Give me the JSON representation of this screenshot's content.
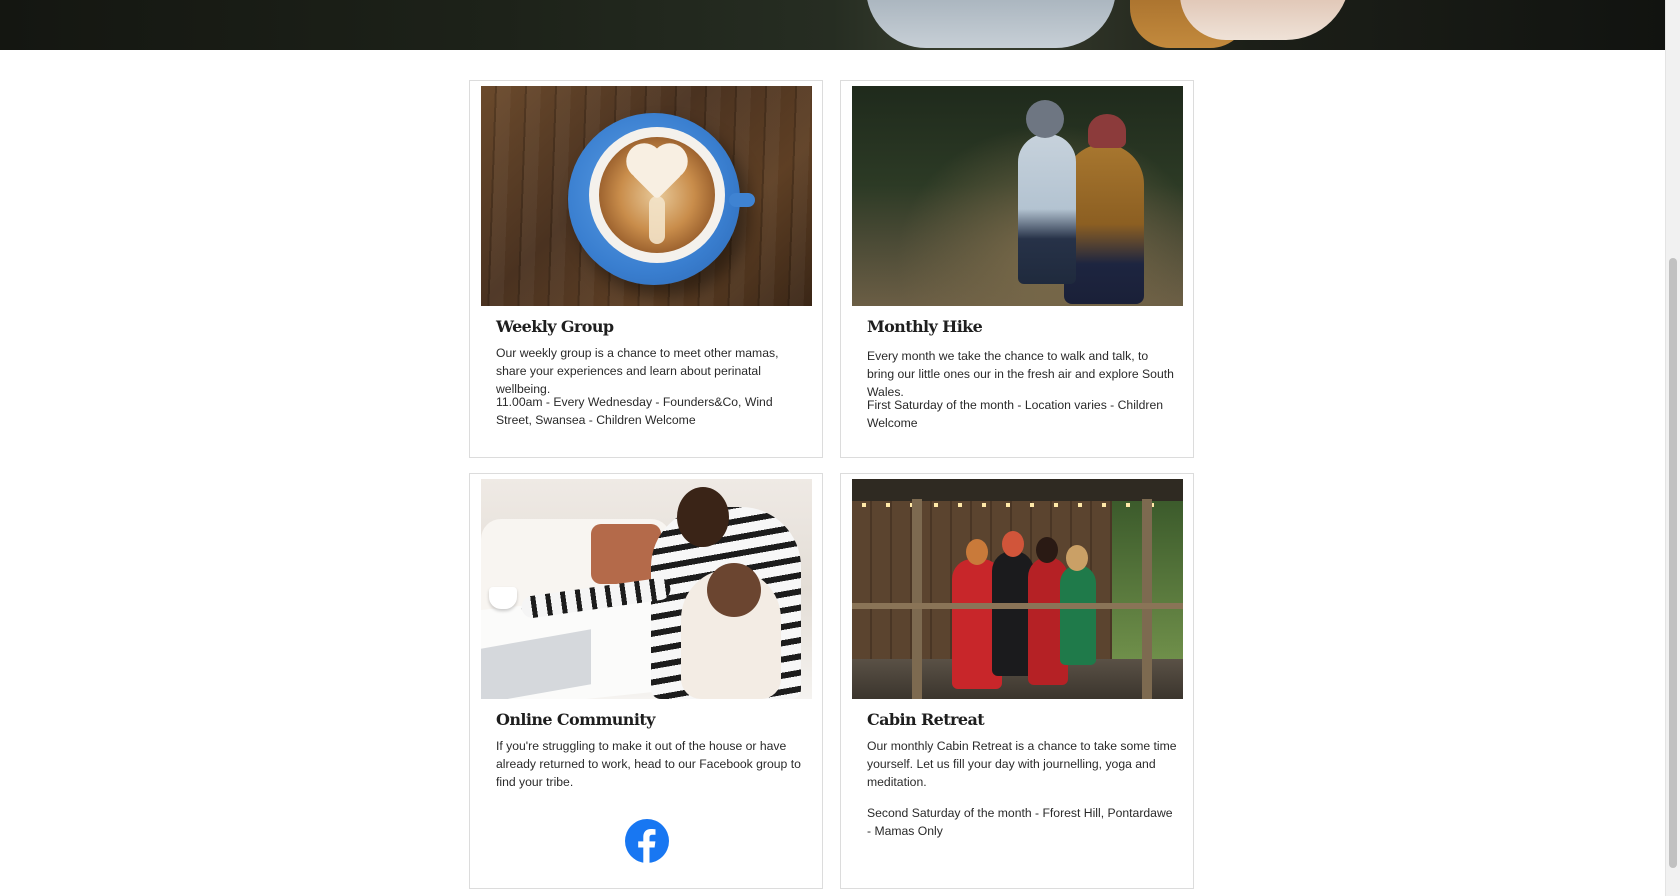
{
  "hero": {
    "image": "family-outdoor-banner"
  },
  "cards": [
    {
      "id": "weekly",
      "image": "latte-art-coffee-photo",
      "title": "Weekly Group",
      "description": "Our weekly group is a chance to meet other mamas, share your experiences and learn about perinatal wellbeing.",
      "details": "11.00am - Every Wednesday - Founders&Co, Wind Street, Swansea - Children Welcome"
    },
    {
      "id": "hike",
      "image": "mother-child-forest-photo",
      "title": "Monthly Hike",
      "description": "Every month we take the chance to walk and talk, to bring our little ones our in the fresh air and explore South Wales.",
      "details": "First Saturday of the month - Location varies - Children Welcome"
    },
    {
      "id": "online",
      "image": "mother-baby-laptop-photo",
      "title": "Online Community",
      "description": "If you're struggling to make it out of the house or have already returned to work, head to our Facebook group to find your tribe.",
      "link_icon": "facebook-icon"
    },
    {
      "id": "cabin",
      "image": "women-cabin-porch-photo",
      "title": "Cabin Retreat",
      "description": "Our monthly Cabin Retreat is a chance to take some time yourself. Let us fill your day with journelling, yoga and meditation.",
      "details": "Second Saturday of the month - Fforest Hill, Pontardawe - Mamas Only"
    }
  ],
  "colors": {
    "facebook": "#1877f2",
    "card_border": "#dcdcdc",
    "title_text": "#1e1e1e",
    "body_text": "#2a2a2a"
  }
}
